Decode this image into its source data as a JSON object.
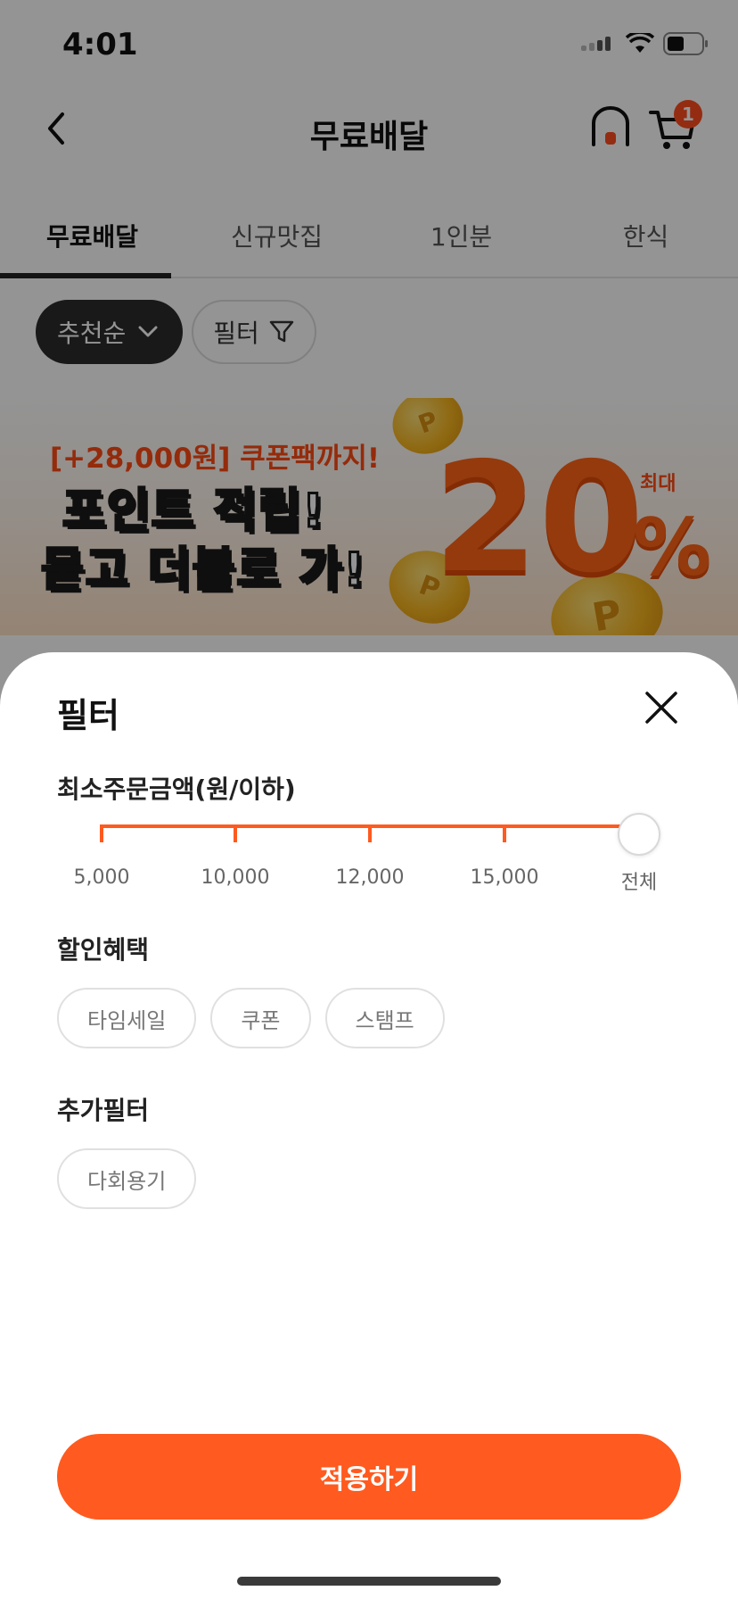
{
  "status_bar": {
    "time": "4:01"
  },
  "header": {
    "title": "무료배달",
    "cart_count": "1"
  },
  "tabs": [
    {
      "label": "무료배달",
      "active": true
    },
    {
      "label": "신규맛집",
      "active": false
    },
    {
      "label": "1인분",
      "active": false
    },
    {
      "label": "한식",
      "active": false
    }
  ],
  "sort": {
    "label": "추천순"
  },
  "filter": {
    "label": "필터"
  },
  "banner": {
    "subtitle": "[+28,000원] 쿠폰팩까지!",
    "line1": "포인트 적립!",
    "line2": "묻고 더블로 가!",
    "max_label": "최대",
    "percent_value": "20",
    "percent_sign": "%",
    "coin_letter": "P"
  },
  "sheet": {
    "title": "필터",
    "min_order": {
      "title": "최소주문금액(원/이하)",
      "options": [
        "5,000",
        "10,000",
        "12,000",
        "15,000",
        "전체"
      ],
      "selected": "전체"
    },
    "discount": {
      "title": "할인혜택",
      "options": [
        "타임세일",
        "쿠폰",
        "스탬프"
      ]
    },
    "extra": {
      "title": "추가필터",
      "options": [
        "다회용기"
      ]
    },
    "apply_label": "적용하기"
  },
  "colors": {
    "accent": "#ff5a1f",
    "badge": "#ff4c1f",
    "dark_chip": "#2b2b2b"
  }
}
